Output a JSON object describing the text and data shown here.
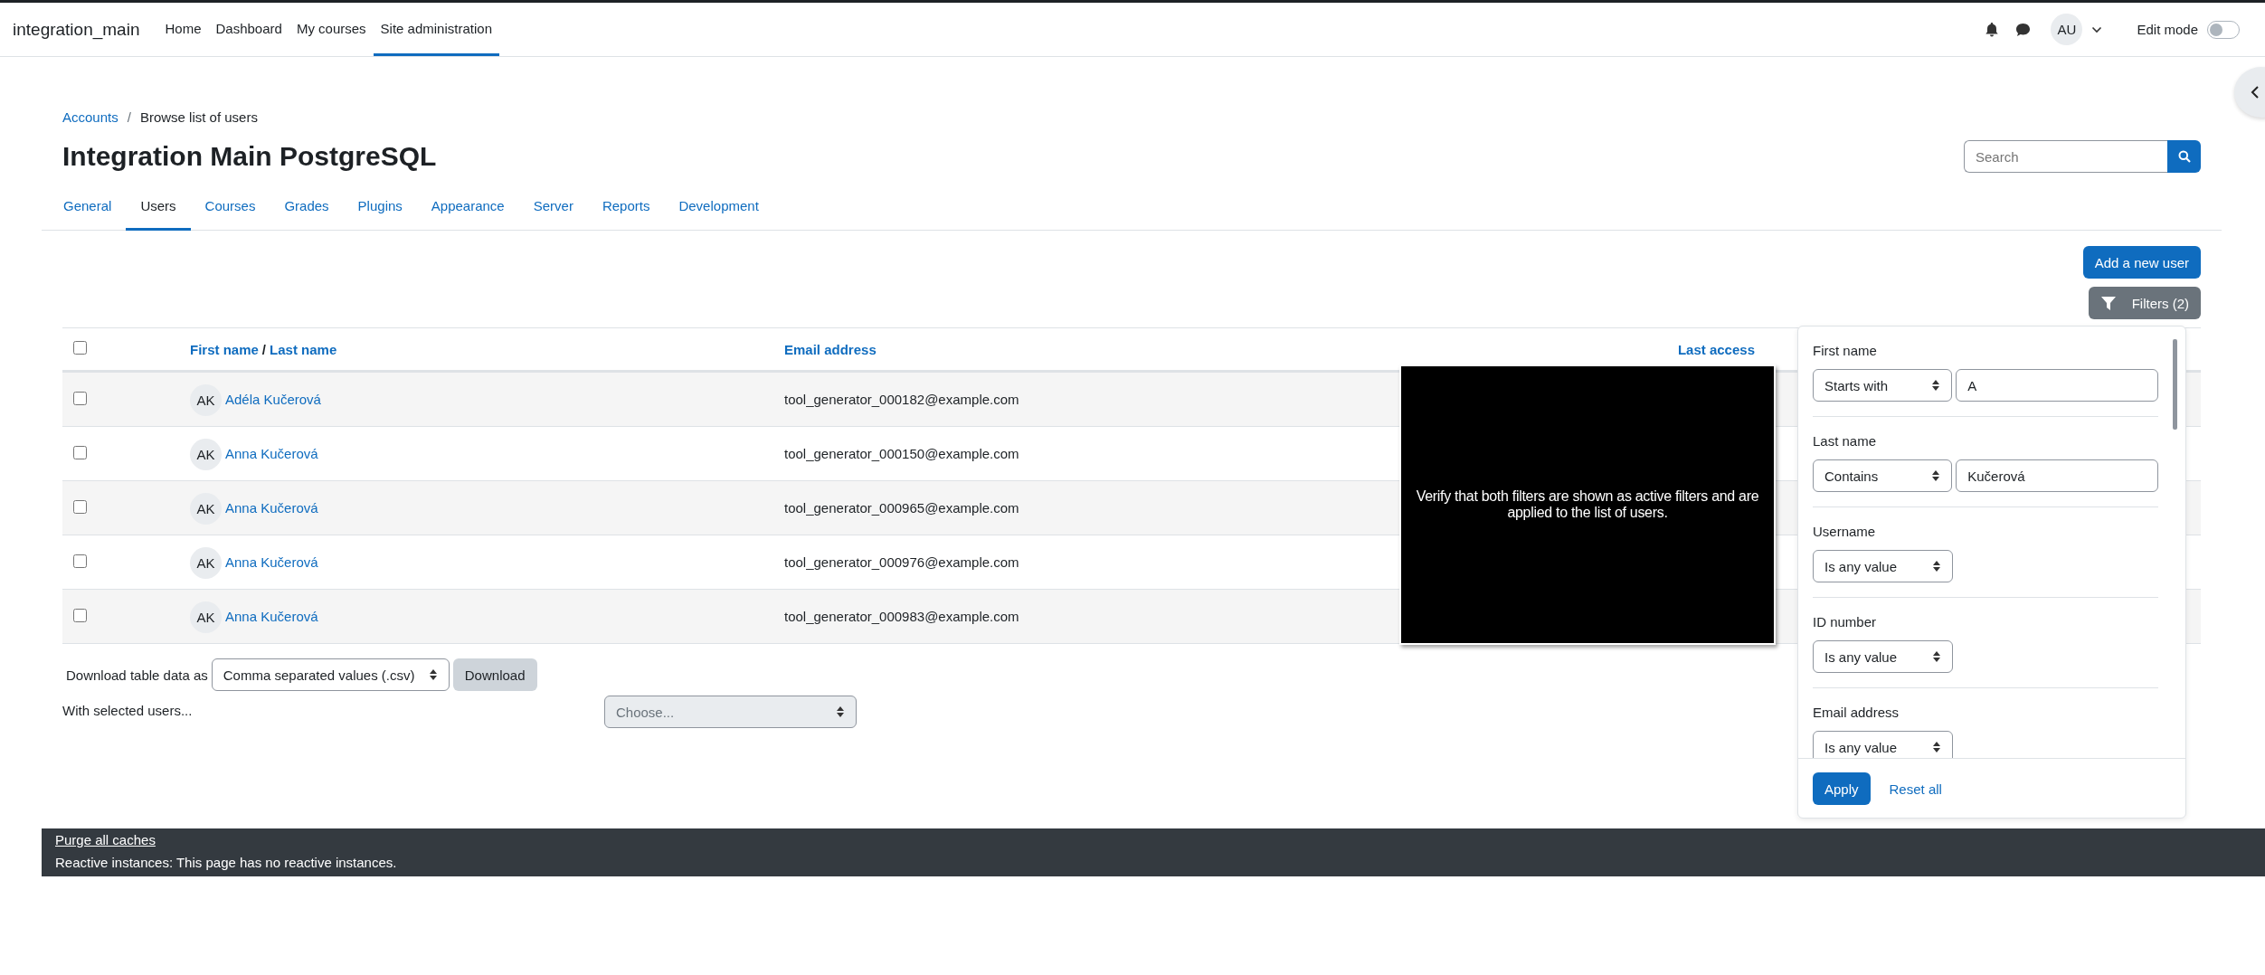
{
  "navbar": {
    "brand": "integration_main",
    "links": [
      {
        "label": "Home",
        "selected": false
      },
      {
        "label": "Dashboard",
        "selected": false
      },
      {
        "label": "My courses",
        "selected": false
      },
      {
        "label": "Site administration",
        "selected": true
      }
    ],
    "user_initials": "AU",
    "edit_mode": {
      "label": "Edit mode",
      "on": false
    }
  },
  "breadcrumb": [
    {
      "label": "Accounts",
      "kind": "link"
    },
    {
      "label": "/",
      "kind": "separator"
    },
    {
      "label": "Browse list of users",
      "kind": "current"
    }
  ],
  "page_title": "Integration Main PostgreSQL",
  "search": {
    "placeholder": "Search"
  },
  "tabs": [
    {
      "label": "General",
      "selected": false
    },
    {
      "label": "Users",
      "selected": true
    },
    {
      "label": "Courses",
      "selected": false
    },
    {
      "label": "Grades",
      "selected": false
    },
    {
      "label": "Plugins",
      "selected": false
    },
    {
      "label": "Appearance",
      "selected": false
    },
    {
      "label": "Server",
      "selected": false
    },
    {
      "label": "Reports",
      "selected": false
    },
    {
      "label": "Development",
      "selected": false
    }
  ],
  "actions": {
    "add_button": "Add a new user",
    "filters_button": "Filters (2)"
  },
  "table": {
    "select_all_checked": false,
    "name_header": [
      "First name",
      "/",
      "Last name"
    ],
    "email_header": "Email address",
    "last_access_header": "Last access",
    "rows": [
      {
        "checked": false,
        "initials": "AK",
        "name": "Adéla Kučerová",
        "email": "tool_generator_000182@example.com"
      },
      {
        "checked": false,
        "initials": "AK",
        "name": "Anna Kučerová",
        "email": "tool_generator_000150@example.com"
      },
      {
        "checked": false,
        "initials": "AK",
        "name": "Anna Kučerová",
        "email": "tool_generator_000965@example.com"
      },
      {
        "checked": false,
        "initials": "AK",
        "name": "Anna Kučerová",
        "email": "tool_generator_000976@example.com"
      },
      {
        "checked": false,
        "initials": "AK",
        "name": "Anna Kučerová",
        "email": "tool_generator_000983@example.com"
      }
    ]
  },
  "download": {
    "label": "Download table data as",
    "format": "Comma separated values (.csv)",
    "button": "Download"
  },
  "bulk": {
    "label": "With selected users...",
    "placeholder": "Choose...",
    "disabled": true
  },
  "overlay": {
    "text": "Verify that both filters are shown as active filters and are applied to the list of users."
  },
  "filter_panel": {
    "filters": [
      {
        "label": "First name",
        "operator": "Starts with",
        "value": "A"
      },
      {
        "label": "Last name",
        "operator": "Contains",
        "value": "Kučerová"
      },
      {
        "label": "Username",
        "operator": "Is any value"
      },
      {
        "label": "ID number",
        "operator": "Is any value"
      },
      {
        "label": "Email address",
        "operator": "Is any value"
      }
    ],
    "apply": "Apply",
    "reset": "Reset all"
  },
  "footer": {
    "link": "Purge all caches",
    "text": "Reactive instances: This page has no reactive instances."
  }
}
